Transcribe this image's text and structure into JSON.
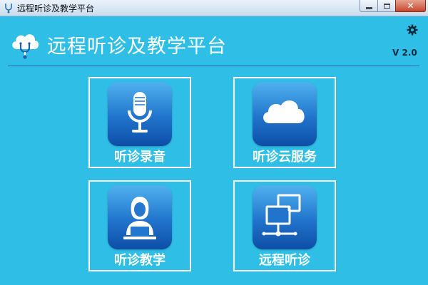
{
  "window": {
    "title": "远程听诊及教学平台",
    "controls": {
      "close_label": "✕"
    }
  },
  "header": {
    "app_title": "远程听诊及教学平台",
    "version": "V 2.0",
    "settings_icon": "gear-icon",
    "logo_icon": "cloud-stethoscope-icon"
  },
  "tiles": [
    {
      "label": "听诊录音",
      "icon": "microphone-icon"
    },
    {
      "label": "听诊云服务",
      "icon": "cloud-icon"
    },
    {
      "label": "听诊教学",
      "icon": "teacher-laptop-icon"
    },
    {
      "label": "远程听诊",
      "icon": "network-computers-icon"
    }
  ],
  "colors": {
    "background": "#2fbfe6",
    "divider": "#1d5fb0",
    "tile_gradient_top": "#4fb2ef",
    "tile_gradient_bottom": "#0d4ea6"
  }
}
